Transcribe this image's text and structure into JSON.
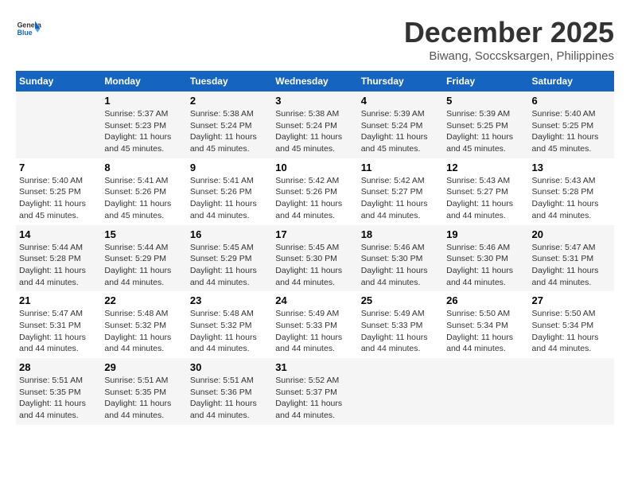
{
  "header": {
    "logo": {
      "general": "General",
      "blue": "Blue"
    },
    "title": "December 2025",
    "subtitle": "Biwang, Soccsksargen, Philippines"
  },
  "calendar": {
    "days_of_week": [
      "Sunday",
      "Monday",
      "Tuesday",
      "Wednesday",
      "Thursday",
      "Friday",
      "Saturday"
    ],
    "weeks": [
      [
        {
          "day": "",
          "info": ""
        },
        {
          "day": "1",
          "info": "Sunrise: 5:37 AM\nSunset: 5:23 PM\nDaylight: 11 hours\nand 45 minutes."
        },
        {
          "day": "2",
          "info": "Sunrise: 5:38 AM\nSunset: 5:24 PM\nDaylight: 11 hours\nand 45 minutes."
        },
        {
          "day": "3",
          "info": "Sunrise: 5:38 AM\nSunset: 5:24 PM\nDaylight: 11 hours\nand 45 minutes."
        },
        {
          "day": "4",
          "info": "Sunrise: 5:39 AM\nSunset: 5:24 PM\nDaylight: 11 hours\nand 45 minutes."
        },
        {
          "day": "5",
          "info": "Sunrise: 5:39 AM\nSunset: 5:25 PM\nDaylight: 11 hours\nand 45 minutes."
        },
        {
          "day": "6",
          "info": "Sunrise: 5:40 AM\nSunset: 5:25 PM\nDaylight: 11 hours\nand 45 minutes."
        }
      ],
      [
        {
          "day": "7",
          "info": "Sunrise: 5:40 AM\nSunset: 5:25 PM\nDaylight: 11 hours\nand 45 minutes."
        },
        {
          "day": "8",
          "info": "Sunrise: 5:41 AM\nSunset: 5:26 PM\nDaylight: 11 hours\nand 45 minutes."
        },
        {
          "day": "9",
          "info": "Sunrise: 5:41 AM\nSunset: 5:26 PM\nDaylight: 11 hours\nand 44 minutes."
        },
        {
          "day": "10",
          "info": "Sunrise: 5:42 AM\nSunset: 5:26 PM\nDaylight: 11 hours\nand 44 minutes."
        },
        {
          "day": "11",
          "info": "Sunrise: 5:42 AM\nSunset: 5:27 PM\nDaylight: 11 hours\nand 44 minutes."
        },
        {
          "day": "12",
          "info": "Sunrise: 5:43 AM\nSunset: 5:27 PM\nDaylight: 11 hours\nand 44 minutes."
        },
        {
          "day": "13",
          "info": "Sunrise: 5:43 AM\nSunset: 5:28 PM\nDaylight: 11 hours\nand 44 minutes."
        }
      ],
      [
        {
          "day": "14",
          "info": "Sunrise: 5:44 AM\nSunset: 5:28 PM\nDaylight: 11 hours\nand 44 minutes."
        },
        {
          "day": "15",
          "info": "Sunrise: 5:44 AM\nSunset: 5:29 PM\nDaylight: 11 hours\nand 44 minutes."
        },
        {
          "day": "16",
          "info": "Sunrise: 5:45 AM\nSunset: 5:29 PM\nDaylight: 11 hours\nand 44 minutes."
        },
        {
          "day": "17",
          "info": "Sunrise: 5:45 AM\nSunset: 5:30 PM\nDaylight: 11 hours\nand 44 minutes."
        },
        {
          "day": "18",
          "info": "Sunrise: 5:46 AM\nSunset: 5:30 PM\nDaylight: 11 hours\nand 44 minutes."
        },
        {
          "day": "19",
          "info": "Sunrise: 5:46 AM\nSunset: 5:30 PM\nDaylight: 11 hours\nand 44 minutes."
        },
        {
          "day": "20",
          "info": "Sunrise: 5:47 AM\nSunset: 5:31 PM\nDaylight: 11 hours\nand 44 minutes."
        }
      ],
      [
        {
          "day": "21",
          "info": "Sunrise: 5:47 AM\nSunset: 5:31 PM\nDaylight: 11 hours\nand 44 minutes."
        },
        {
          "day": "22",
          "info": "Sunrise: 5:48 AM\nSunset: 5:32 PM\nDaylight: 11 hours\nand 44 minutes."
        },
        {
          "day": "23",
          "info": "Sunrise: 5:48 AM\nSunset: 5:32 PM\nDaylight: 11 hours\nand 44 minutes."
        },
        {
          "day": "24",
          "info": "Sunrise: 5:49 AM\nSunset: 5:33 PM\nDaylight: 11 hours\nand 44 minutes."
        },
        {
          "day": "25",
          "info": "Sunrise: 5:49 AM\nSunset: 5:33 PM\nDaylight: 11 hours\nand 44 minutes."
        },
        {
          "day": "26",
          "info": "Sunrise: 5:50 AM\nSunset: 5:34 PM\nDaylight: 11 hours\nand 44 minutes."
        },
        {
          "day": "27",
          "info": "Sunrise: 5:50 AM\nSunset: 5:34 PM\nDaylight: 11 hours\nand 44 minutes."
        }
      ],
      [
        {
          "day": "28",
          "info": "Sunrise: 5:51 AM\nSunset: 5:35 PM\nDaylight: 11 hours\nand 44 minutes."
        },
        {
          "day": "29",
          "info": "Sunrise: 5:51 AM\nSunset: 5:35 PM\nDaylight: 11 hours\nand 44 minutes."
        },
        {
          "day": "30",
          "info": "Sunrise: 5:51 AM\nSunset: 5:36 PM\nDaylight: 11 hours\nand 44 minutes."
        },
        {
          "day": "31",
          "info": "Sunrise: 5:52 AM\nSunset: 5:37 PM\nDaylight: 11 hours\nand 44 minutes."
        },
        {
          "day": "",
          "info": ""
        },
        {
          "day": "",
          "info": ""
        },
        {
          "day": "",
          "info": ""
        }
      ]
    ]
  }
}
